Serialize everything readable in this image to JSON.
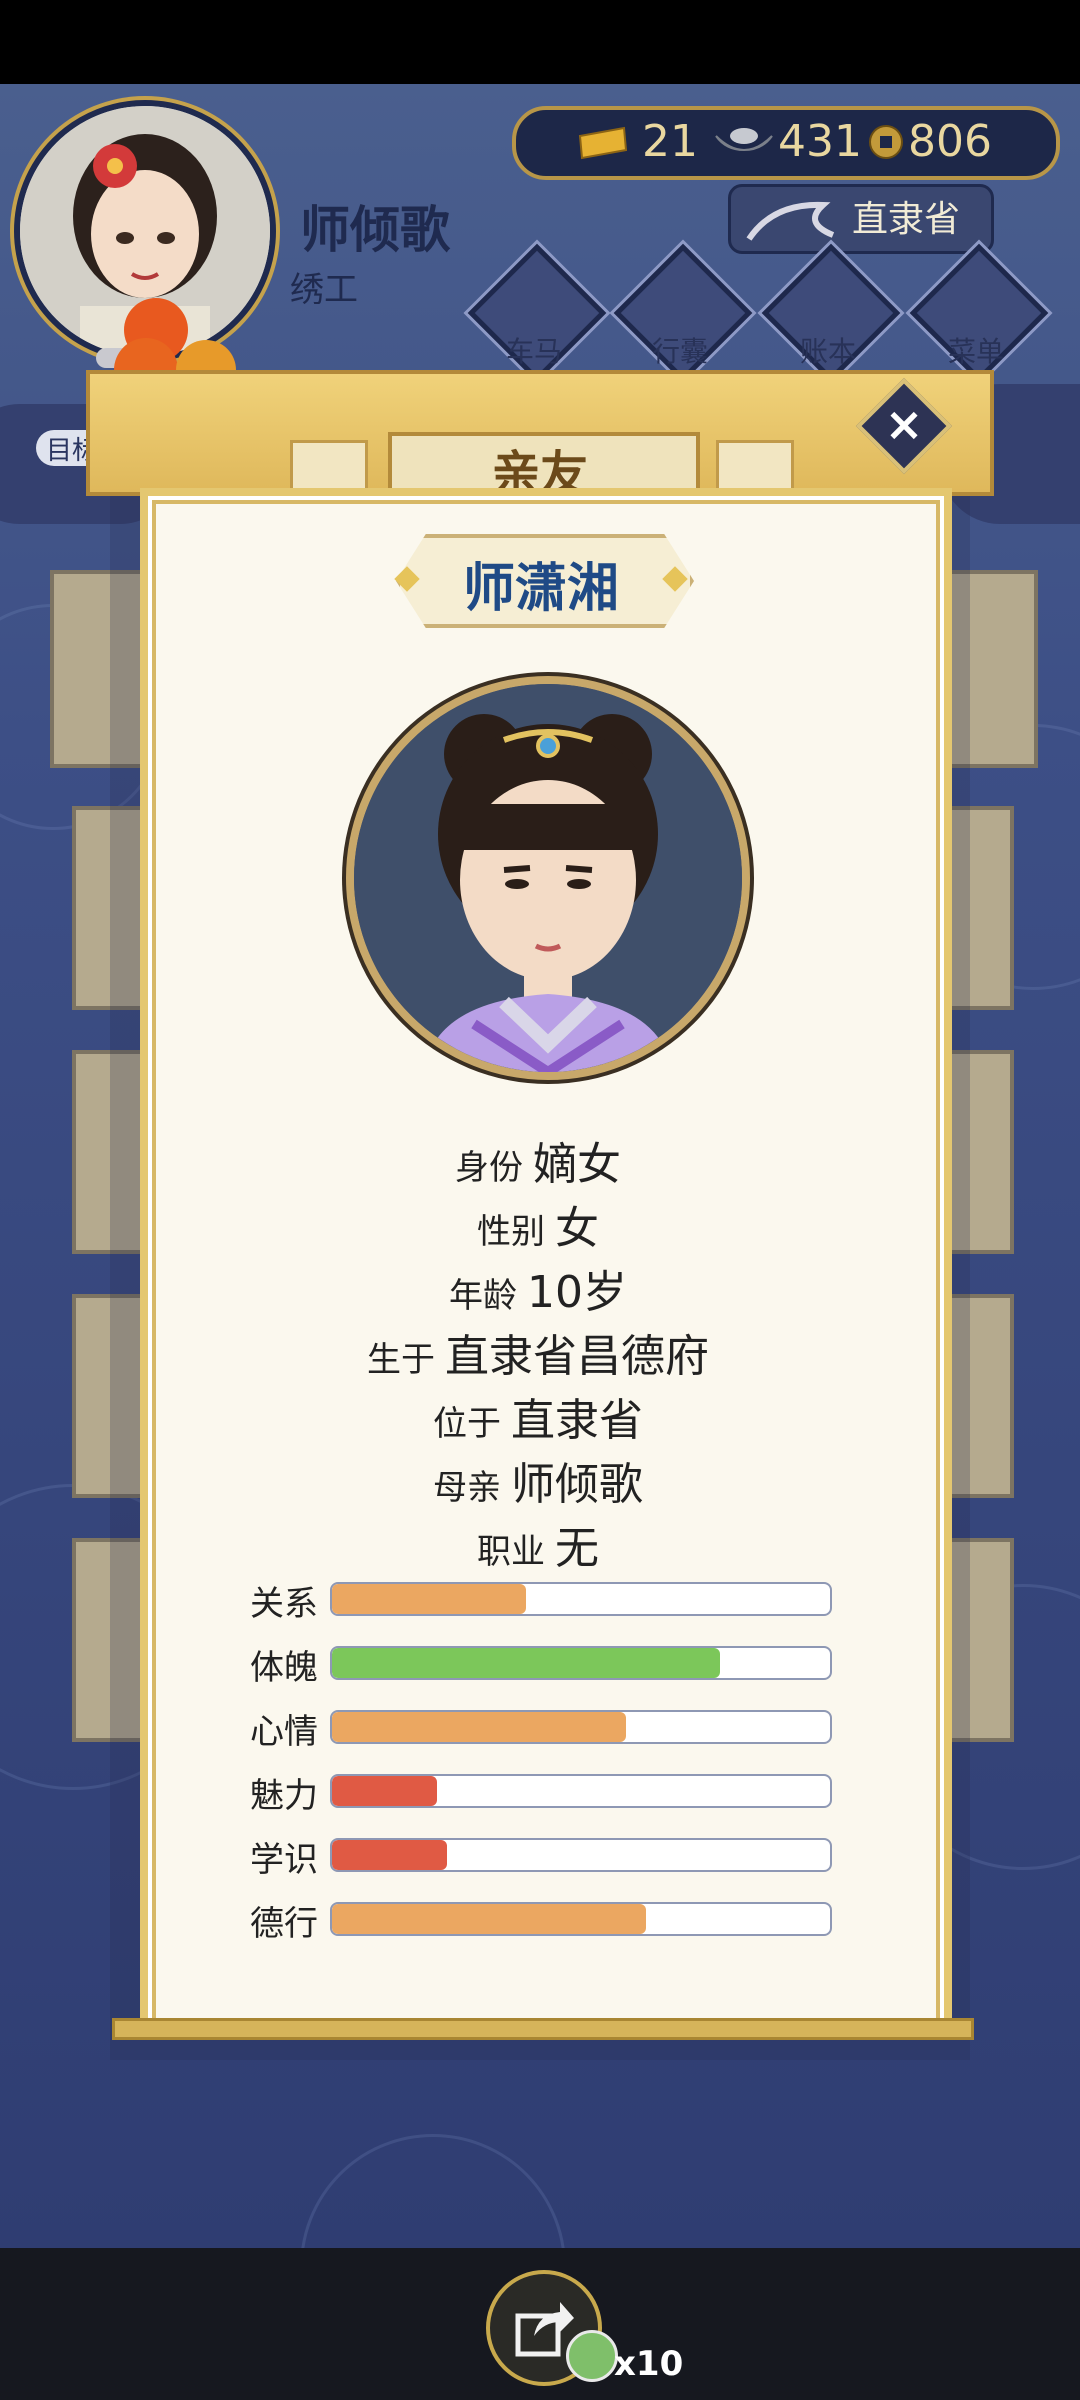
{
  "player": {
    "name": "师倾歌",
    "job": "绣工"
  },
  "currency": {
    "gold": "21",
    "silver": "431",
    "coin": "806"
  },
  "location": "直隶省",
  "menu": [
    {
      "label": "车马",
      "icon": "carriage-icon"
    },
    {
      "label": "行囊",
      "icon": "bag-icon"
    },
    {
      "label": "账本",
      "icon": "ledger-icon"
    },
    {
      "label": "菜单",
      "icon": "more-icon"
    }
  ],
  "goal_label": "目标",
  "dialog": {
    "title": "亲友",
    "close_icon": "close-icon",
    "person_name": "师潇湘",
    "info": [
      {
        "label": "身份",
        "value": "嫡女"
      },
      {
        "label": "性别",
        "value": "女"
      },
      {
        "label": "年龄",
        "value": "10岁"
      },
      {
        "label": "生于",
        "value": "直隶省昌德府"
      },
      {
        "label": "位于",
        "value": "直隶省"
      },
      {
        "label": "母亲",
        "value": "师倾歌"
      },
      {
        "label": "职业",
        "value": "无"
      }
    ],
    "stats": [
      {
        "label": "关系",
        "level": 0.39,
        "color": "#eba761"
      },
      {
        "label": "体魄",
        "level": 0.78,
        "color": "#7cc75a"
      },
      {
        "label": "心情",
        "level": 0.59,
        "color": "#eba761"
      },
      {
        "label": "魅力",
        "level": 0.21,
        "color": "#e05a44"
      },
      {
        "label": "学识",
        "level": 0.23,
        "color": "#e05a44"
      },
      {
        "label": "德行",
        "level": 0.63,
        "color": "#eba761"
      }
    ]
  },
  "share": {
    "count": "x10",
    "icon": "share-icon"
  }
}
